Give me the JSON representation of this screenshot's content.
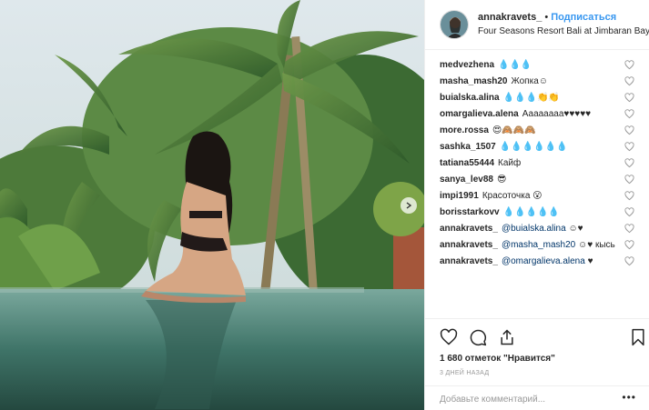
{
  "header": {
    "username": "annakravets_",
    "separator": "•",
    "follow_label": "Подписаться",
    "location": "Four Seasons Resort Bali at Jimbaran Bay"
  },
  "comments": [
    {
      "user": "medvezhena",
      "text": "💧💧💧"
    },
    {
      "user": "masha_mash20",
      "text": "Жопка☺"
    },
    {
      "user": "buialska.alina",
      "text": "💧💧💧👏👏"
    },
    {
      "user": "omargalieva.alena",
      "text": "Аааааааа♥♥♥♥♥"
    },
    {
      "user": "more.rossa",
      "text": "😍🙈🙈🙈"
    },
    {
      "user": "sashka_1507",
      "text": "💧💧💧💧💧💧"
    },
    {
      "user": "tatiana55444",
      "text": "Кайф"
    },
    {
      "user": "sanya_lev88",
      "text": "😎"
    },
    {
      "user": "impi1991",
      "text": "Красоточка 😮"
    },
    {
      "user": "borisstarkovv",
      "text": "💧💧💧💧💧"
    },
    {
      "user": "annakravets_",
      "mention": "@buialska.alina",
      "text": " ☺♥"
    },
    {
      "user": "annakravets_",
      "mention": "@masha_mash20",
      "text": " ☺♥ кысь"
    },
    {
      "user": "annakravets_",
      "mention": "@omargalieva.alena",
      "text": " ♥"
    }
  ],
  "likes": "1 680 отметок \"Нравится\"",
  "time": "3 ДНЕЙ НАЗАД",
  "add_comment": {
    "placeholder": "Добавьте комментарий..."
  },
  "more_label": "•••",
  "icons": {
    "like": "heart-icon",
    "comment": "comment-icon",
    "share": "share-icon",
    "save": "bookmark-icon",
    "comment_like": "small-heart-icon"
  },
  "colors": {
    "link": "#3897f0",
    "mention": "#003569",
    "muted": "#999999",
    "border": "#efefef"
  }
}
